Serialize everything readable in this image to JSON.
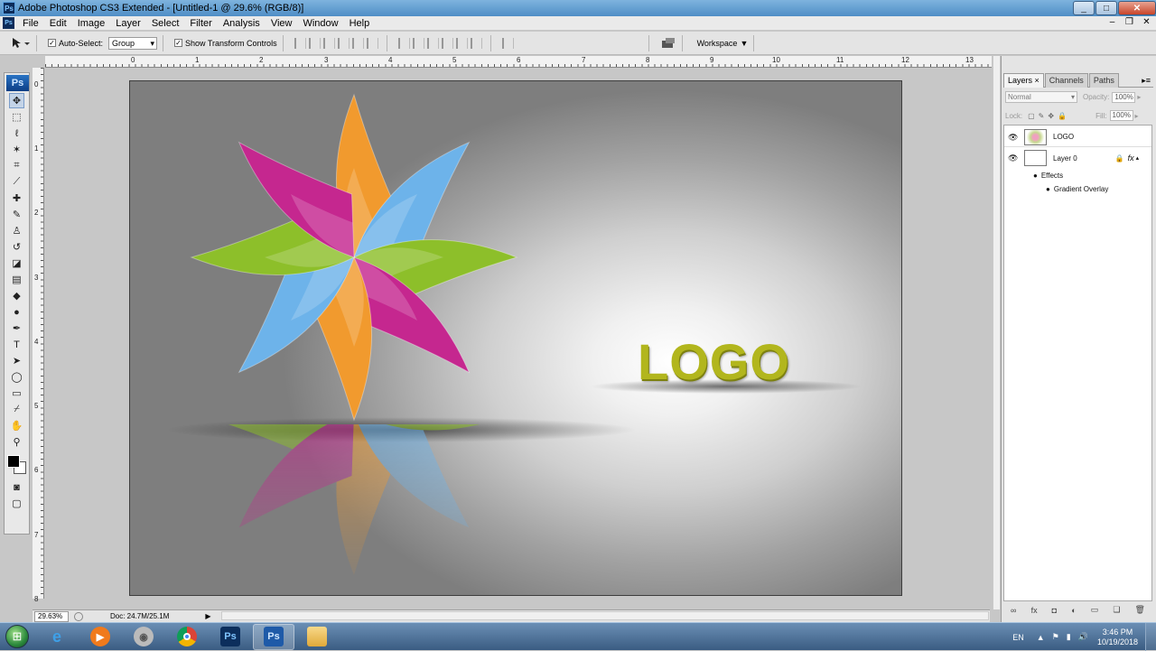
{
  "window": {
    "title": "Adobe Photoshop CS3 Extended - [Untitled-1 @ 29.6% (RGB/8)]",
    "app_icon": "Ps",
    "controls": [
      "_",
      "□",
      "✕"
    ]
  },
  "menubar": {
    "app_icon": "Ps",
    "items": [
      "File",
      "Edit",
      "Image",
      "Layer",
      "Select",
      "Filter",
      "Analysis",
      "View",
      "Window",
      "Help"
    ],
    "doc_controls": [
      "–",
      "❐",
      "✕"
    ]
  },
  "options": {
    "auto_select_label": "Auto-Select:",
    "auto_select_value": "Group",
    "show_transform_label": "Show Transform Controls",
    "workspace_label": "Workspace"
  },
  "ruler": {
    "top": [
      "0",
      "1",
      "2",
      "3",
      "4",
      "5",
      "6",
      "7",
      "8",
      "9",
      "10",
      "11",
      "12",
      "13"
    ],
    "left": [
      "0",
      "1",
      "2",
      "3",
      "4",
      "5",
      "6",
      "7",
      "8"
    ]
  },
  "toolbox": {
    "logo": "Ps",
    "tools": [
      "move-icon",
      "marquee-icon",
      "lasso-icon",
      "magic-wand-icon",
      "crop-icon",
      "slice-icon",
      "healing-brush-icon",
      "brush-icon",
      "clone-stamp-icon",
      "history-brush-icon",
      "eraser-icon",
      "gradient-icon",
      "blur-icon",
      "dodge-icon",
      "pen-icon",
      "type-icon",
      "path-selection-icon",
      "shape-icon",
      "notes-icon",
      "eyedropper-icon",
      "hand-icon",
      "zoom-icon"
    ]
  },
  "canvas": {
    "logo_text": "LOGO",
    "logo_color": "#b2b61d",
    "petal_colors": [
      "#f19a2e",
      "#6db3ea",
      "#8dbf2a",
      "#c5278f"
    ]
  },
  "status": {
    "zoom": "29.63%",
    "doc": "Doc: 24.7M/25.1M"
  },
  "layers_panel": {
    "tabs": [
      "Layers",
      "Channels",
      "Paths"
    ],
    "blend_mode": "Normal",
    "opacity_label": "Opacity:",
    "opacity": "100%",
    "lock_label": "Lock:",
    "fill_label": "Fill:",
    "fill": "100%",
    "layers": [
      {
        "name": "LOGO"
      },
      {
        "name": "Layer 0",
        "effects_label": "Effects",
        "effect": "Gradient Overlay"
      }
    ]
  },
  "taskbar": {
    "lang": "EN",
    "time": "3:46 PM",
    "date": "10/19/2018",
    "apps": [
      "Internet Explorer",
      "Media Player",
      "Media Center",
      "Chrome",
      "Photoshop",
      "Photoshop",
      "Explorer"
    ]
  }
}
